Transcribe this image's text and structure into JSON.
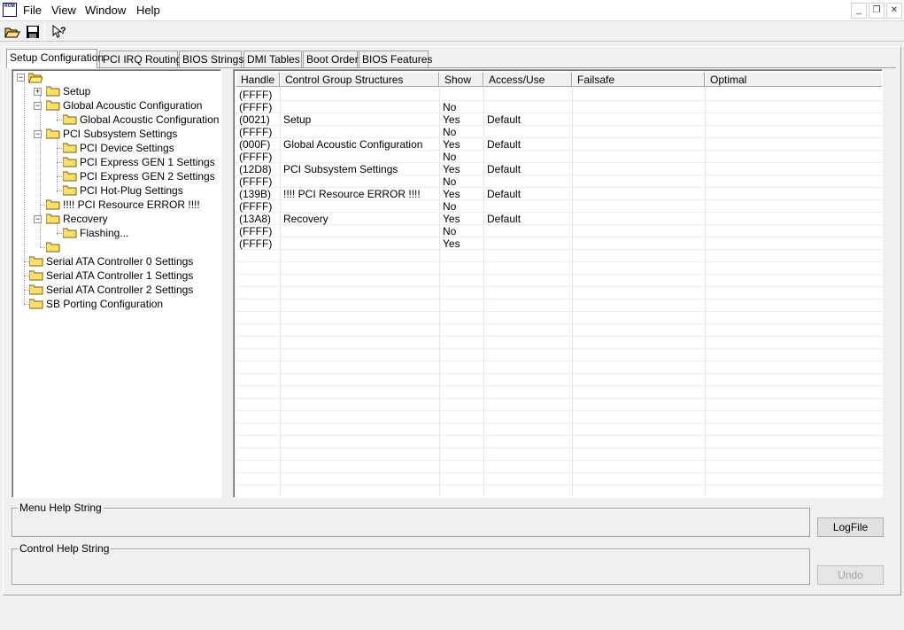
{
  "menu": {
    "file": "File",
    "view": "View",
    "window": "Window",
    "help": "Help"
  },
  "app_icon_text": "ROM",
  "window_controls": {
    "minimize": "_",
    "restore": "❐",
    "close": "✕"
  },
  "toolbar": {
    "open_icon": "folder-open-icon",
    "save_icon": "save-icon",
    "help_icon": "help-pointer-icon"
  },
  "tabs": [
    {
      "label": "Setup Configuration"
    },
    {
      "label": "PCI IRQ Routing"
    },
    {
      "label": "BIOS Strings"
    },
    {
      "label": "DMI Tables"
    },
    {
      "label": "Boot Order"
    },
    {
      "label": "BIOS Features"
    }
  ],
  "tree": {
    "nodes": [
      {
        "label": "Setup"
      },
      {
        "label": "Global Acoustic Configuration"
      },
      {
        "label": "Global Acoustic Configuration"
      },
      {
        "label": "PCI Subsystem Settings"
      },
      {
        "label": "PCI Device Settings"
      },
      {
        "label": "PCI Express GEN 1 Settings"
      },
      {
        "label": "PCI Express GEN 2 Settings"
      },
      {
        "label": "PCI Hot-Plug Settings"
      },
      {
        "label": "!!!! PCI Resource ERROR !!!!"
      },
      {
        "label": "Recovery"
      },
      {
        "label": "Flashing..."
      },
      {
        "label": ""
      },
      {
        "label": "Serial ATA Controller 0 Settings"
      },
      {
        "label": "Serial ATA Controller 1 Settings"
      },
      {
        "label": "Serial ATA Controller 2 Settings"
      },
      {
        "label": "SB Porting Configuration"
      }
    ]
  },
  "grid": {
    "columns": [
      "Handle",
      "Control Group Structures",
      "Show",
      "Access/Use",
      "Failsafe",
      "Optimal"
    ],
    "rows": [
      [
        "(FFFF)",
        "",
        "",
        "",
        "",
        ""
      ],
      [
        "(FFFF)",
        "",
        "No",
        "",
        "",
        ""
      ],
      [
        "(0021)",
        "Setup",
        "Yes",
        "Default",
        "",
        ""
      ],
      [
        "(FFFF)",
        "",
        "No",
        "",
        "",
        ""
      ],
      [
        "(000F)",
        "Global Acoustic Configuration",
        "Yes",
        "Default",
        "",
        ""
      ],
      [
        "(FFFF)",
        "",
        "No",
        "",
        "",
        ""
      ],
      [
        "(12D8)",
        "PCI Subsystem Settings",
        "Yes",
        "Default",
        "",
        ""
      ],
      [
        "(FFFF)",
        "",
        "No",
        "",
        "",
        ""
      ],
      [
        "(139B)",
        "!!!! PCI Resource ERROR !!!!",
        "Yes",
        "Default",
        "",
        ""
      ],
      [
        "(FFFF)",
        "",
        "No",
        "",
        "",
        ""
      ],
      [
        "(13A8)",
        "Recovery",
        "Yes",
        "Default",
        "",
        ""
      ],
      [
        "(FFFF)",
        "",
        "No",
        "",
        "",
        ""
      ],
      [
        "(FFFF)",
        "",
        "Yes",
        "",
        "",
        ""
      ]
    ]
  },
  "menu_help": {
    "title": "Menu Help String"
  },
  "control_help": {
    "title": "Control Help String"
  },
  "buttons": {
    "logfile": "LogFile",
    "undo": "Undo"
  }
}
